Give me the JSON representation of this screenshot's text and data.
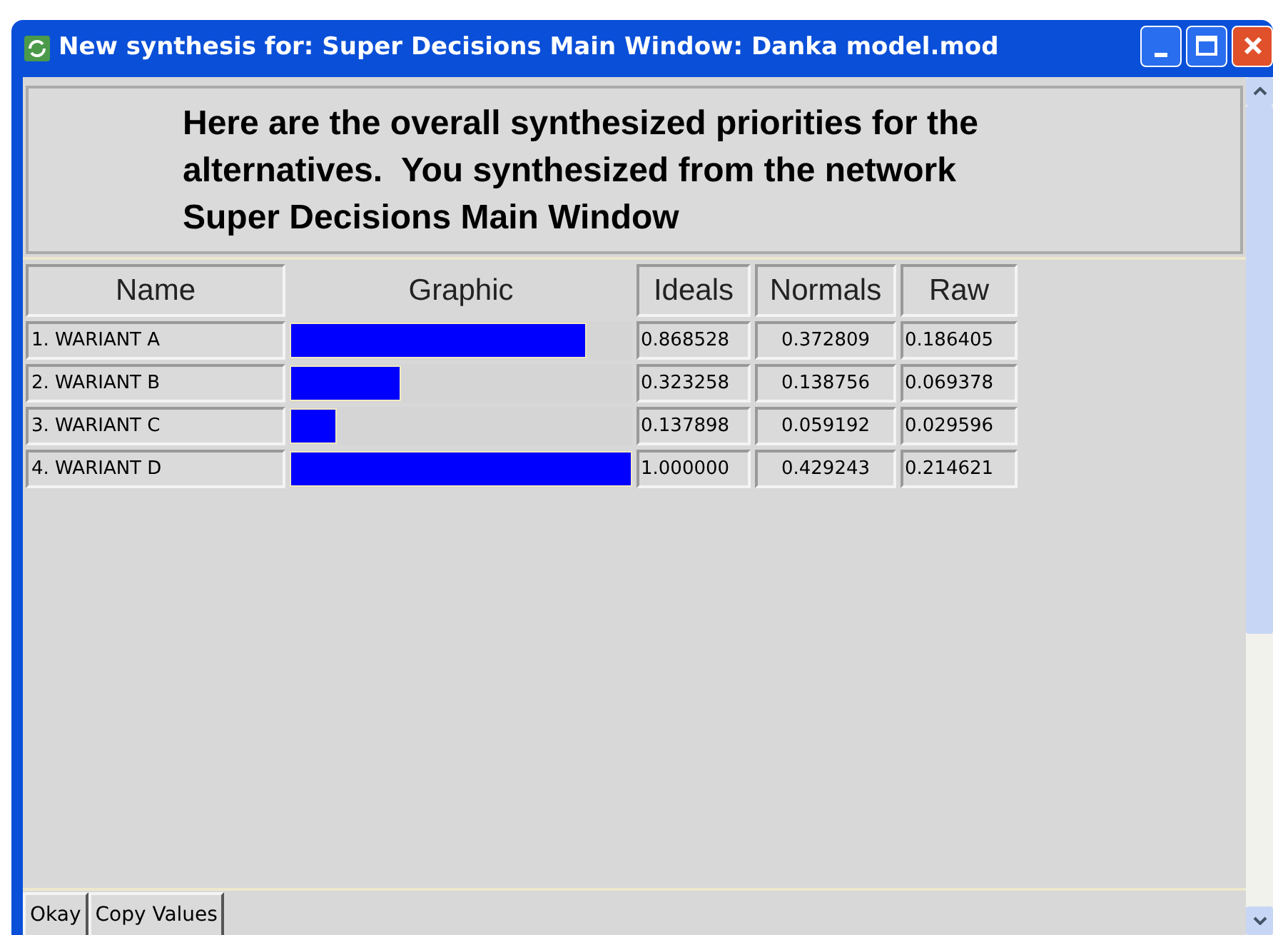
{
  "window": {
    "title": "New synthesis for: Super Decisions Main Window: Danka model.mod"
  },
  "message": "Here are the overall synthesized priorities for the alternatives.  You synthesized from the network Super Decisions Main Window",
  "table": {
    "columns": [
      "Name",
      "Graphic",
      "Ideals",
      "Normals",
      "Raw"
    ],
    "rows": [
      {
        "name": "1. WARIANT A",
        "level": 0.868528,
        "ideals": "0.868528",
        "normals": "0.372809",
        "raw": "0.186405"
      },
      {
        "name": "2. WARIANT B",
        "level": 0.323258,
        "ideals": "0.323258",
        "normals": "0.138756",
        "raw": "0.069378"
      },
      {
        "name": "3. WARIANT C",
        "level": 0.137898,
        "ideals": "0.137898",
        "normals": "0.059192",
        "raw": "0.029596"
      },
      {
        "name": "4. WARIANT D",
        "level": 1.0,
        "ideals": "1.000000",
        "normals": "0.429243",
        "raw": "0.214621"
      }
    ]
  },
  "buttons": [
    "Okay",
    "Copy Values"
  ]
}
